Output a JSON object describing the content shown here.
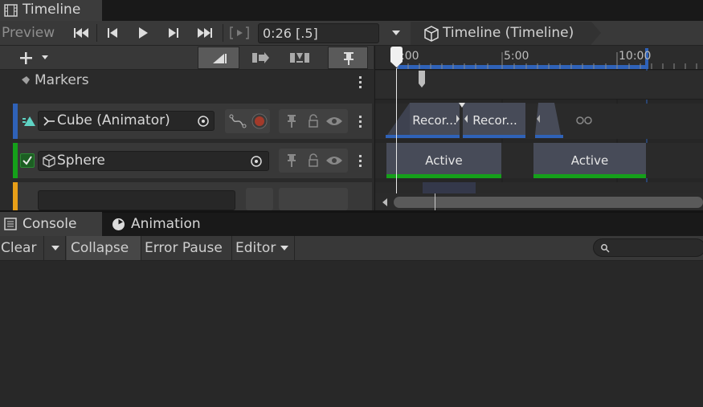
{
  "timeline_window": {
    "tab_title": "Timeline",
    "preview_label": "Preview",
    "playhead_field": "0:26 [.5]",
    "breadcrumb": "Timeline (Timeline)",
    "ruler_ticks": [
      ":00",
      "5:00",
      "10:00"
    ],
    "markers_label": "Markers",
    "tracks": [
      {
        "name": "Cube (Animator)",
        "clips": [
          "Recor...",
          "Recor..."
        ]
      },
      {
        "name": "Sphere",
        "clips": [
          "Active",
          "Active"
        ]
      }
    ],
    "accent": "#2f62b8",
    "active_green": "#15a01a"
  },
  "console_window": {
    "tabs": [
      "Console",
      "Animation"
    ],
    "toolbar": {
      "clear": "Clear",
      "collapse": "Collapse",
      "error_pause": "Error Pause",
      "editor": "Editor"
    }
  }
}
